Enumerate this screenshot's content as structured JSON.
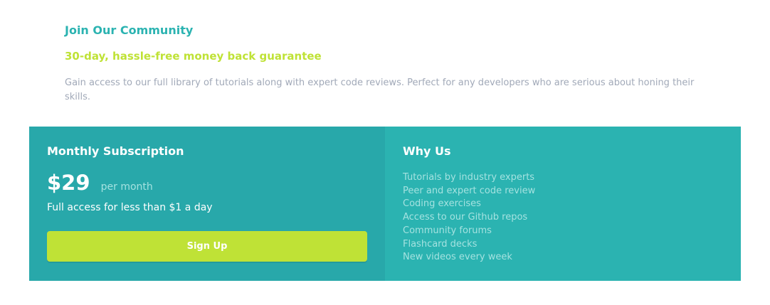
{
  "intro": {
    "title": "Join Our Community",
    "subtitle": "30-day, hassle-free money back guarantee",
    "description": "Gain access to our full library of tutorials along with expert code reviews. Perfect for any developers who are serious about honing their skills."
  },
  "subscription": {
    "title": "Monthly Subscription",
    "price": "$29",
    "period": "per month",
    "tagline": "Full access for less than $1 a day",
    "button_label": "Sign Up"
  },
  "why_us": {
    "title": "Why Us",
    "items": [
      "Tutorials by industry experts",
      "Peer and expert code review",
      "Coding exercises",
      "Access to our Github repos",
      "Community forums",
      "Flashcard decks",
      "New videos every week"
    ]
  },
  "colors": {
    "teal": "#2bb3b1",
    "teal_dark": "#28a8aa",
    "lime": "#bfe236",
    "grey_text": "#a1a9b8"
  }
}
